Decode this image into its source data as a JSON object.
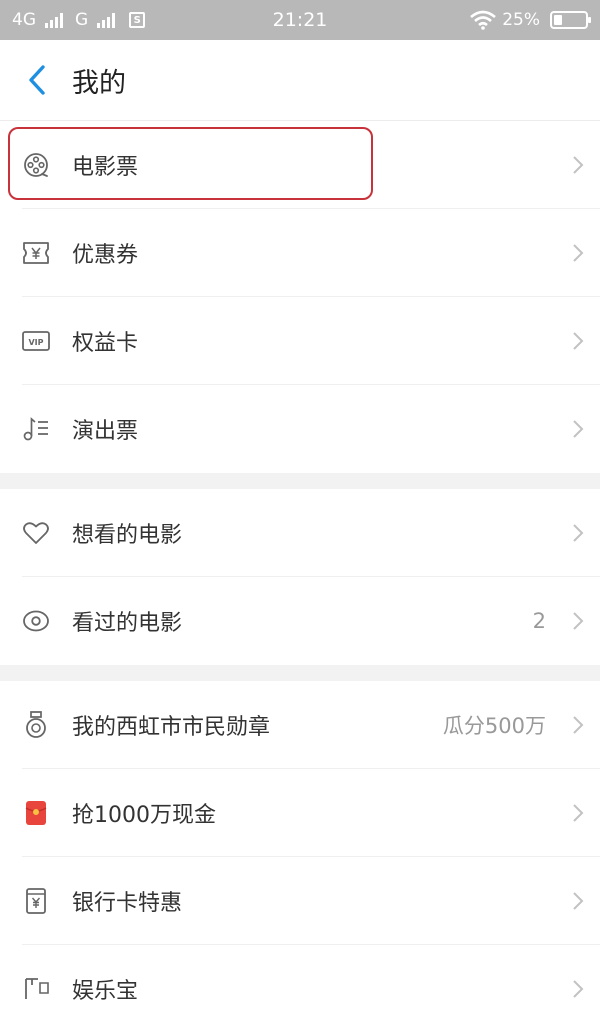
{
  "status_bar": {
    "network1": "4G",
    "network2": "G",
    "sim_badge": "S",
    "time": "21:21",
    "battery_pct": "25%",
    "battery_level": 0.25
  },
  "header": {
    "title": "我的"
  },
  "groups": [
    [
      {
        "label": "电影票",
        "icon": "film-reel-icon",
        "value": ""
      },
      {
        "label": "优惠券",
        "icon": "coupon-icon",
        "value": ""
      },
      {
        "label": "权益卡",
        "icon": "vip-card-icon",
        "value": ""
      },
      {
        "label": "演出票",
        "icon": "music-note-icon",
        "value": ""
      }
    ],
    [
      {
        "label": "想看的电影",
        "icon": "heart-icon",
        "value": ""
      },
      {
        "label": "看过的电影",
        "icon": "eye-icon",
        "value": "2"
      }
    ],
    [
      {
        "label": "我的西虹市市民勋章",
        "icon": "medal-icon",
        "value": "瓜分500万"
      },
      {
        "label": "抢1000万现金",
        "icon": "red-envelope-icon",
        "value": ""
      },
      {
        "label": "银行卡特惠",
        "icon": "bank-card-icon",
        "value": ""
      },
      {
        "label": "娱乐宝",
        "icon": "entertainment-icon",
        "value": ""
      }
    ]
  ],
  "colors": {
    "accent": "#1e8fe1",
    "highlight": "#c8323a",
    "red_envelope": "#e8453c"
  }
}
